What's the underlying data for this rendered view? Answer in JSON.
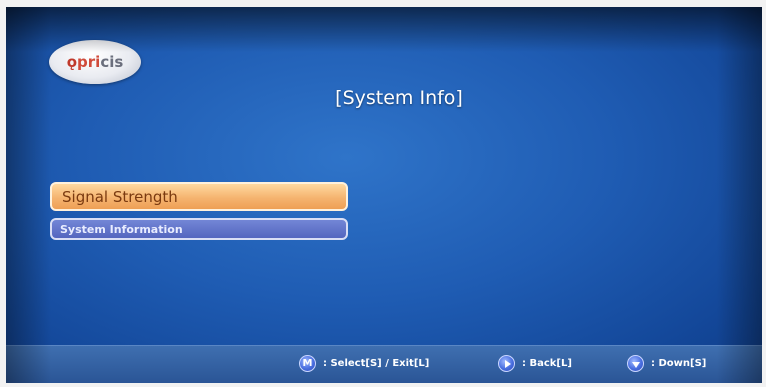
{
  "logo": {
    "part1": "ǫ",
    "part2": "pri",
    "part3": "cis"
  },
  "title": "[System Info]",
  "menu": {
    "items": [
      {
        "label": "Signal Strength",
        "selected": true
      },
      {
        "label": "System Information",
        "selected": false
      }
    ]
  },
  "footer": {
    "hints": [
      {
        "icon": "m-button-icon",
        "icon_text": "M",
        "label": ": Select[S] / Exit[L]"
      },
      {
        "icon": "right-arrow-button-icon",
        "label": ": Back[L]"
      },
      {
        "icon": "down-arrow-button-icon",
        "label": ": Down[S]"
      }
    ]
  },
  "colors": {
    "background": "#1f5cb3",
    "selected_item": "#f5b470",
    "normal_item": "#5466bf",
    "footer": "#2a5596"
  }
}
